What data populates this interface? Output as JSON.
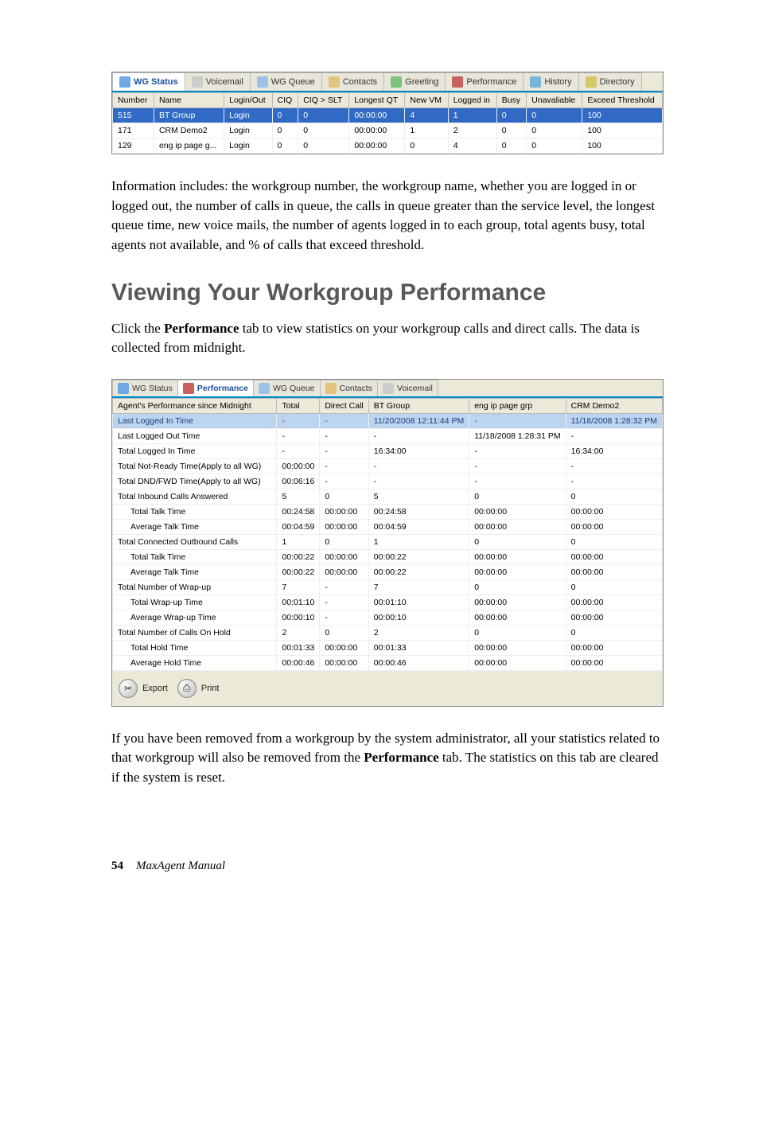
{
  "tabs1": {
    "items": [
      {
        "label": "WG Status",
        "active": true,
        "iconColor": "#6da9e4"
      },
      {
        "label": "Voicemail",
        "active": false,
        "iconColor": "#ccc"
      },
      {
        "label": "WG Queue",
        "active": false,
        "iconColor": "#9ec1e6"
      },
      {
        "label": "Contacts",
        "active": false,
        "iconColor": "#e3c47e"
      },
      {
        "label": "Greeting",
        "active": false,
        "iconColor": "#7cc17c"
      },
      {
        "label": "Performance",
        "active": false,
        "iconColor": "#c9615f"
      },
      {
        "label": "History",
        "active": false,
        "iconColor": "#7bb5d9"
      },
      {
        "label": "Directory",
        "active": false,
        "iconColor": "#d6c864"
      }
    ]
  },
  "grid1": {
    "headers": [
      "Number",
      "Name",
      "Login/Out",
      "CIQ",
      "CIQ > SLT",
      "Longest QT",
      "New VM",
      "Logged in",
      "Busy",
      "Unavaliable",
      "Exceed Threshold"
    ],
    "rows": [
      {
        "cells": [
          "515",
          "BT Group",
          "Login",
          "0",
          "0",
          "00:00:00",
          "4",
          "1",
          "0",
          "0",
          "100"
        ],
        "selected": true
      },
      {
        "cells": [
          "171",
          "CRM Demo2",
          "Login",
          "0",
          "0",
          "00:00:00",
          "1",
          "2",
          "0",
          "0",
          "100"
        ],
        "selected": false
      },
      {
        "cells": [
          "129",
          "eng ip page g...",
          "Login",
          "0",
          "0",
          "00:00:00",
          "0",
          "4",
          "0",
          "0",
          "100"
        ],
        "selected": false
      }
    ]
  },
  "para1": "Information includes: the workgroup number, the workgroup name, whether you are logged in or logged out, the number of calls in queue, the calls in queue greater than the service level, the longest queue time, new voice mails, the number of agents logged in to each group, total agents busy, total agents not available, and % of calls that exceed threshold.",
  "heading": "Viewing Your Workgroup Performance",
  "para2a": "Click the ",
  "para2b": "Performance",
  "para2c": " tab to view statistics on your workgroup calls and direct calls. The data is collected from midnight.",
  "tabs2": {
    "items": [
      {
        "label": "WG Status",
        "active": false,
        "iconColor": "#6da9e4"
      },
      {
        "label": "Performance",
        "active": true,
        "iconColor": "#c9615f"
      },
      {
        "label": "WG Queue",
        "active": false,
        "iconColor": "#9ec1e6"
      },
      {
        "label": "Contacts",
        "active": false,
        "iconColor": "#e3c47e"
      },
      {
        "label": "Voicemail",
        "active": false,
        "iconColor": "#ccc"
      }
    ]
  },
  "grid2": {
    "headers": [
      "Agent's Performance since Midnight",
      "Total",
      "Direct Call",
      "BT Group",
      "eng ip page grp",
      "CRM Demo2"
    ],
    "rows": [
      {
        "cells": [
          "Last Logged In Time",
          "-",
          "-",
          "11/20/2008 12:11:44 PM",
          "-",
          "11/18/2008 1:28:32 PM"
        ],
        "highlight": true
      },
      {
        "cells": [
          "Last Logged Out Time",
          "-",
          "-",
          "-",
          "11/18/2008 1:28:31 PM",
          "-"
        ]
      },
      {
        "cells": [
          "Total Logged In Time",
          "-",
          "-",
          "16:34:00",
          "-",
          "16:34:00"
        ]
      },
      {
        "cells": [
          "Total Not-Ready Time(Apply to all WG)",
          "00:00:00",
          "-",
          "-",
          "-",
          "-"
        ]
      },
      {
        "cells": [
          "Total DND/FWD Time(Apply to all WG)",
          "00:06:16",
          "-",
          "-",
          "-",
          "-"
        ]
      },
      {
        "cells": [
          "Total Inbound Calls Answered",
          "5",
          "0",
          "5",
          "0",
          "0"
        ]
      },
      {
        "cells": [
          "Total Talk Time",
          "00:24:58",
          "00:00:00",
          "00:24:58",
          "00:00:00",
          "00:00:00"
        ],
        "indent": true
      },
      {
        "cells": [
          "Average Talk Time",
          "00:04:59",
          "00:00:00",
          "00:04:59",
          "00:00:00",
          "00:00:00"
        ],
        "indent": true
      },
      {
        "cells": [
          "Total Connected Outbound Calls",
          "1",
          "0",
          "1",
          "0",
          "0"
        ]
      },
      {
        "cells": [
          "Total Talk Time",
          "00:00:22",
          "00:00:00",
          "00:00:22",
          "00:00:00",
          "00:00:00"
        ],
        "indent": true
      },
      {
        "cells": [
          "Average Talk Time",
          "00:00:22",
          "00:00:00",
          "00:00:22",
          "00:00:00",
          "00:00:00"
        ],
        "indent": true
      },
      {
        "cells": [
          "Total Number of Wrap-up",
          "7",
          "-",
          "7",
          "0",
          "0"
        ]
      },
      {
        "cells": [
          "Total Wrap-up Time",
          "00:01:10",
          "-",
          "00:01:10",
          "00:00:00",
          "00:00:00"
        ],
        "indent": true
      },
      {
        "cells": [
          "Average Wrap-up Time",
          "00:00:10",
          "-",
          "00:00:10",
          "00:00:00",
          "00:00:00"
        ],
        "indent": true
      },
      {
        "cells": [
          "Total Number of Calls On Hold",
          "2",
          "0",
          "2",
          "0",
          "0"
        ]
      },
      {
        "cells": [
          "Total Hold Time",
          "00:01:33",
          "00:00:00",
          "00:01:33",
          "00:00:00",
          "00:00:00"
        ],
        "indent": true
      },
      {
        "cells": [
          "Average Hold Time",
          "00:00:46",
          "00:00:00",
          "00:00:46",
          "00:00:00",
          "00:00:00"
        ],
        "indent": true
      }
    ]
  },
  "actions": {
    "export": "Export",
    "print": "Print"
  },
  "para3a": "If you have been removed from a workgroup by the system administrator, all your statistics related to that workgroup will also be removed from the ",
  "para3b": "Performance",
  "para3c": " tab. The statistics on this tab are cleared if the system is reset.",
  "footer": {
    "page": "54",
    "book": "MaxAgent Manual"
  }
}
